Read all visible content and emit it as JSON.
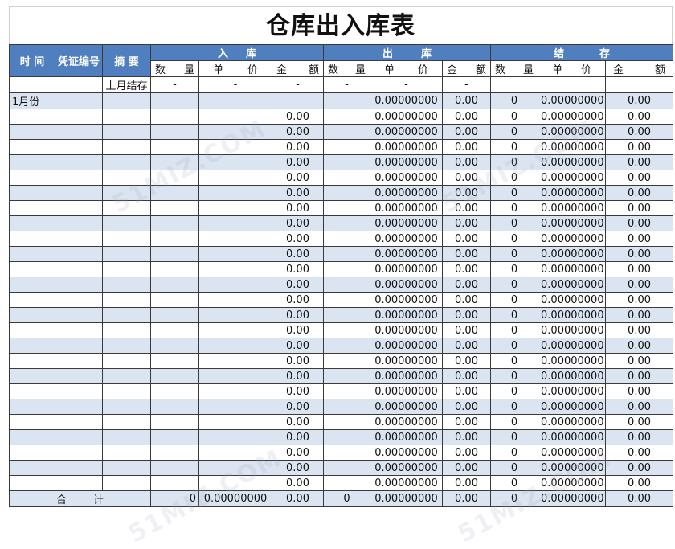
{
  "title": "仓库出入库表",
  "headers": {
    "time": "时 间",
    "voucher": "凭证编号",
    "summary": "摘 要",
    "in": [
      "入",
      "库"
    ],
    "out": [
      "出",
      "库"
    ],
    "balance": [
      "结",
      "存"
    ]
  },
  "sub_headers": {
    "qty": [
      "数",
      "量"
    ],
    "price": [
      "单",
      "价"
    ],
    "amount": [
      "金",
      "额"
    ]
  },
  "opening_row": {
    "summary": "上月结存",
    "in_qty": "-",
    "in_price": "-",
    "in_amount": "-",
    "out_qty": "-",
    "out_price": "-",
    "out_amount": "-",
    "bal_qty": "",
    "bal_price": "",
    "bal_amount": ""
  },
  "first_row": {
    "time": "1月份",
    "in_amount": "",
    "out_price": "0.00000000",
    "out_amount": "0.00",
    "bal_qty": "0",
    "bal_price": "0.00000000",
    "bal_amount": "0.00"
  },
  "row_values": {
    "in_amount": "0.00",
    "out_price": "0.00000000",
    "out_amount": "0.00",
    "bal_qty": "0",
    "bal_price": "0.00000000",
    "bal_amount": "0.00"
  },
  "empty_row_count": 25,
  "total_row": {
    "label": [
      "合",
      "计"
    ],
    "in_qty": "0",
    "in_price": "0.00000000",
    "in_amount": "0.00",
    "out_qty": "0",
    "out_price": "0.00000000",
    "out_amount": "0.00",
    "bal_qty": "0",
    "bal_price": "0.00000000",
    "bal_amount": "0.00"
  },
  "watermark": "51MIZ.COM",
  "colors": {
    "header_bg": "#4f7fbf",
    "alt_row_bg": "#dbe5f1"
  }
}
